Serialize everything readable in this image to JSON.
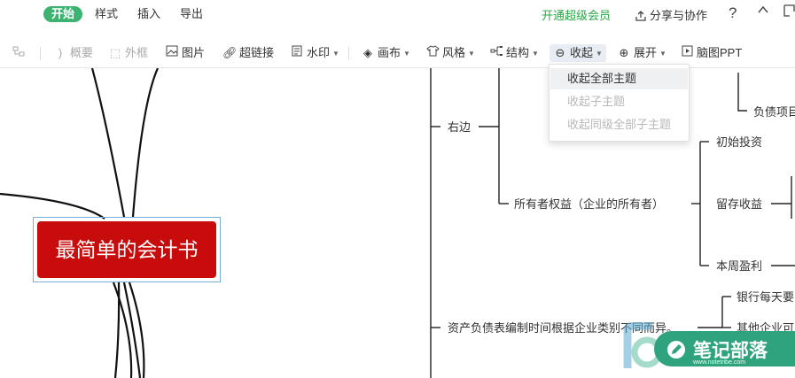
{
  "menu": {
    "tabs": [
      "开始",
      "样式",
      "插入",
      "导出"
    ],
    "vip_label": "开通超级会员",
    "share_label": "分享与协作"
  },
  "toolbar": {
    "summary": "概要",
    "frame": "外框",
    "image": "图片",
    "hyperlink": "超链接",
    "watermark": "水印",
    "canvas": "画布",
    "style": "风格",
    "structure": "结构",
    "collapse": "收起",
    "expand": "展开",
    "ppt": "脑图PPT"
  },
  "collapse_menu": {
    "items": [
      {
        "label": "收起全部主题",
        "enabled": true
      },
      {
        "label": "收起子主题",
        "enabled": false
      },
      {
        "label": "收起同级全部子主题",
        "enabled": false
      }
    ]
  },
  "mindmap": {
    "root": "最简单的会计书",
    "nodes": {
      "right": "右边",
      "equity": "所有者权益（企业的所有者）",
      "initial_investment": "初始投资",
      "retained_earnings": "留存收益",
      "weekly_profit": "本周盈利",
      "liability_item": "负债项目",
      "balance_sheet_time": "资产负债表编制时间根据企业类别不同而异。",
      "bank_daily": "银行每天要",
      "other_companies": "其他企业可"
    }
  },
  "watermark": {
    "title": "笔记部落",
    "url": "www.notetribe.com"
  }
}
